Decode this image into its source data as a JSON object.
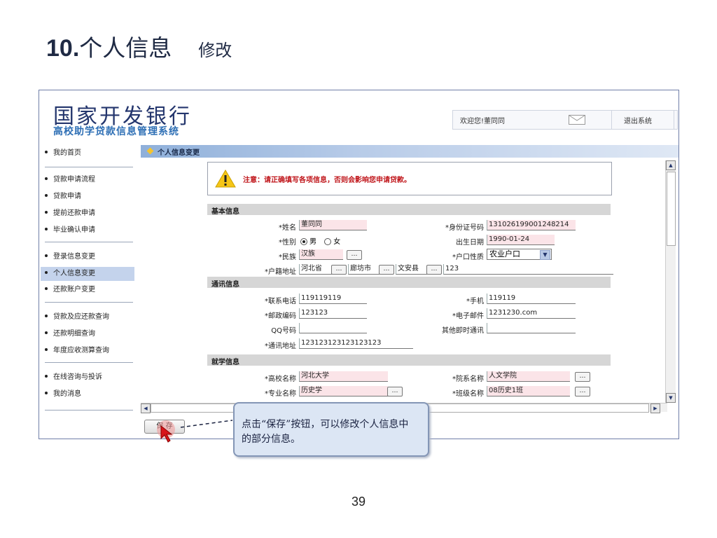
{
  "slide": {
    "title_num": "10.",
    "title_main": "个人信息",
    "title_sub": "修改",
    "page_number": "39"
  },
  "header": {
    "logo_main": "国家开发银行",
    "logo_sub": "高校助学贷款信息管理系统",
    "welcome": "欢迎您!董同同",
    "logout": "退出系统"
  },
  "sidebar": {
    "items": [
      {
        "label": "我的首页"
      },
      {
        "label": "贷款申请流程"
      },
      {
        "label": "贷款申请"
      },
      {
        "label": "提前还款申请"
      },
      {
        "label": "毕业确认申请"
      },
      {
        "label": "登录信息变更"
      },
      {
        "label": "个人信息变更"
      },
      {
        "label": "还款账户变更"
      },
      {
        "label": "贷款及应还款查询"
      },
      {
        "label": "还款明细查询"
      },
      {
        "label": "年度应收测算查询"
      },
      {
        "label": "在线咨询与投诉"
      },
      {
        "label": "我的消息"
      }
    ]
  },
  "main": {
    "tab_title": "个人信息变更",
    "notice": "注意：请正确填写各项信息，否则会影响您申请贷款。",
    "sections": {
      "basic": "基本信息",
      "contact": "通讯信息",
      "school": "就学信息"
    },
    "fields": {
      "name_label": "*姓名",
      "name": "董同同",
      "id_label": "*身份证号码",
      "id": "131026199001248214",
      "gender_label": "*性别",
      "gender_male": "男",
      "gender_female": "女",
      "birth_label": "出生日期",
      "birth": "1990-01-24",
      "ethnic_label": "*民族",
      "ethnic": "汉族",
      "hukou_type_label": "*户口性质",
      "hukou_type": "农业户口",
      "address_label": "*户籍地址",
      "province": "河北省",
      "city": "廊坊市",
      "county": "文安县",
      "address_detail": "123",
      "phone_label": "*联系电话",
      "phone": "119119119",
      "mobile_label": "*手机",
      "mobile": "119119",
      "zip_label": "*邮政编码",
      "zip": "123123",
      "email_label": "*电子邮件",
      "email": "1231230.com",
      "qq_label": "QQ号码",
      "qq": "",
      "im_label": "其他即时通讯",
      "im": "",
      "mail_addr_label": "*通讯地址",
      "mail_addr": "123123123123123123",
      "school_label": "*高校名称",
      "school": "河北大学",
      "dept_label": "*院系名称",
      "dept": "人文学院",
      "major_label": "*专业名称",
      "major": "历史学",
      "class_label": "*班级名称",
      "class": "08历史1班"
    },
    "ellipsis": "…",
    "save_label": "保 存"
  },
  "callout": {
    "text": "点击“保存”按钮，可以修改个人信息中的部分信息。"
  },
  "colors": {
    "notice_red": "#c0161b",
    "logo_blue": "#24366d",
    "active_item": "#c4d3ec"
  }
}
